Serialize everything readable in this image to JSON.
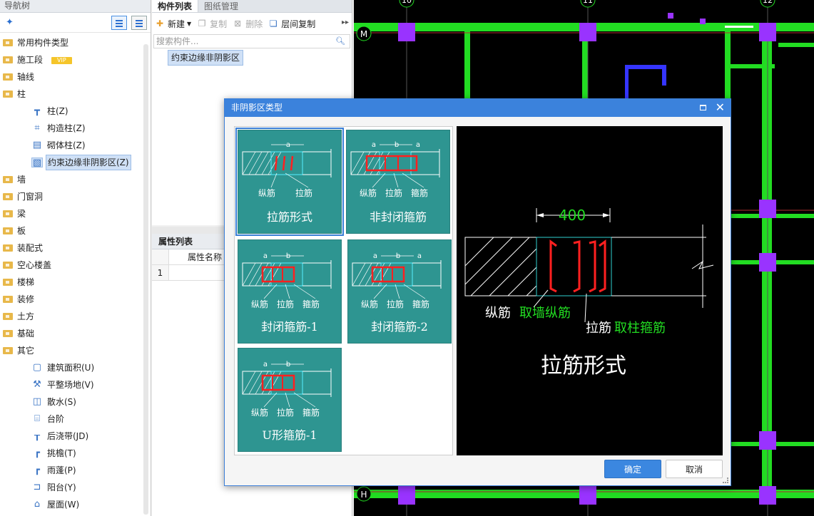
{
  "nav": {
    "title": "导航树",
    "items": [
      {
        "label": "常用构件类型",
        "type": "folder"
      },
      {
        "label": "施工段",
        "type": "folder",
        "badge": "VIP"
      },
      {
        "label": "轴线",
        "type": "folder"
      },
      {
        "label": "柱",
        "type": "folder"
      },
      {
        "label": "柱(Z)",
        "type": "child",
        "icon": "column-icon"
      },
      {
        "label": "构造柱(Z)",
        "type": "child",
        "icon": "construct-column-icon"
      },
      {
        "label": "砌体柱(Z)",
        "type": "child",
        "icon": "masonry-column-icon"
      },
      {
        "label": "约束边缘非阴影区(Z)",
        "type": "child",
        "icon": "hatch-area-icon",
        "selected": true
      },
      {
        "label": "墙",
        "type": "folder"
      },
      {
        "label": "门窗洞",
        "type": "folder"
      },
      {
        "label": "梁",
        "type": "folder"
      },
      {
        "label": "板",
        "type": "folder"
      },
      {
        "label": "装配式",
        "type": "folder"
      },
      {
        "label": "空心楼盖",
        "type": "folder"
      },
      {
        "label": "楼梯",
        "type": "folder"
      },
      {
        "label": "装修",
        "type": "folder"
      },
      {
        "label": "土方",
        "type": "folder"
      },
      {
        "label": "基础",
        "type": "folder"
      },
      {
        "label": "其它",
        "type": "folder"
      },
      {
        "label": "建筑面积(U)",
        "type": "child",
        "icon": "area-icon"
      },
      {
        "label": "平整场地(V)",
        "type": "child",
        "icon": "shovel-icon"
      },
      {
        "label": "散水(S)",
        "type": "child",
        "icon": "apron-icon"
      },
      {
        "label": "台阶",
        "type": "child",
        "icon": "steps-icon"
      },
      {
        "label": "后浇带(JD)",
        "type": "child",
        "icon": "post-cast-strip-icon"
      },
      {
        "label": "挑檐(T)",
        "type": "child",
        "icon": "eave-icon"
      },
      {
        "label": "雨蓬(P)",
        "type": "child",
        "icon": "canopy-icon"
      },
      {
        "label": "阳台(Y)",
        "type": "child",
        "icon": "balcony-icon"
      },
      {
        "label": "屋面(W)",
        "type": "child",
        "icon": "roof-icon"
      }
    ]
  },
  "comp": {
    "tabs": [
      "构件列表",
      "图纸管理"
    ],
    "toolbar": {
      "new": "新建",
      "copy": "复制",
      "delete": "删除",
      "floor_copy": "层间复制"
    },
    "search_placeholder": "搜索构件...",
    "item": "约束边缘非阴影区"
  },
  "prop": {
    "title": "属性列表",
    "col": "属性名称",
    "row_num": "1"
  },
  "cad": {
    "axis_labels": [
      "10",
      "11",
      "12"
    ],
    "row_labels": [
      "M",
      "H"
    ]
  },
  "dialog": {
    "title": "非阴影区类型",
    "options": [
      {
        "caption": "拉筋形式",
        "labels": [
          "纵筋",
          "拉筋"
        ],
        "dims": [
          "a"
        ]
      },
      {
        "caption": "非封闭箍筋",
        "labels": [
          "纵筋",
          "拉筋",
          "箍筋"
        ],
        "dims": [
          "a",
          "b",
          "a"
        ]
      },
      {
        "caption": "封闭箍筋-1",
        "labels": [
          "纵筋",
          "拉筋",
          "箍筋"
        ],
        "dims": [
          "a",
          "b"
        ]
      },
      {
        "caption": "封闭箍筋-2",
        "labels": [
          "纵筋",
          "拉筋",
          "箍筋"
        ],
        "dims": [
          "a",
          "b",
          "a"
        ]
      },
      {
        "caption": "U形箍筋-1",
        "labels": [
          "纵筋",
          "拉筋",
          "箍筋"
        ],
        "dims": [
          "a",
          "b"
        ]
      }
    ],
    "preview": {
      "dim": "400",
      "label1": "纵筋",
      "label1_green": "取墙纵筋",
      "label2": "拉筋",
      "label2_green": "取柱箍筋",
      "caption": "拉筋形式"
    },
    "ok": "确定",
    "cancel": "取消",
    "colors": {
      "tile": "#2e9591",
      "rebar": "#ff2020",
      "green": "#22dd22",
      "title_bar": "#3b82dc"
    }
  }
}
